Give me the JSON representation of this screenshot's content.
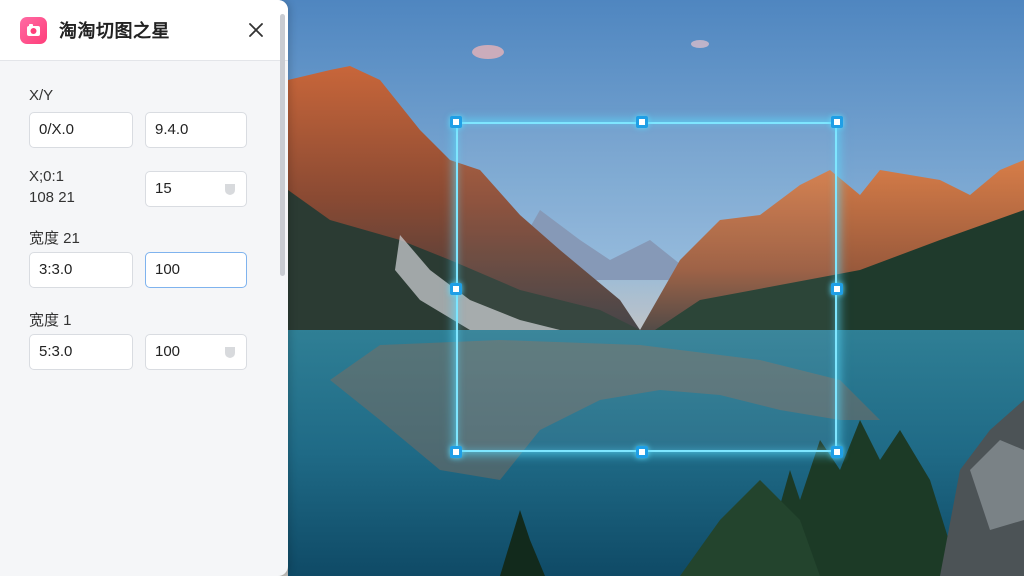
{
  "app": {
    "title": "淘淘切图之星",
    "logo_icon": "app-logo-icon",
    "close_icon": "close-icon"
  },
  "panel": {
    "xy_label": "X/Y",
    "x_value": "0/X.0",
    "y_value": "9.4.0",
    "ratio_label_line1": "X;0:1",
    "ratio_label_line2": "108 21",
    "ratio_value": "15",
    "width_label_a": "宽度 21",
    "width_value_a": "3:3.0",
    "height_value_a": "100",
    "width_label_b": "宽度 1",
    "width_value_b": "5:3.0",
    "height_value_b": "100"
  },
  "colors": {
    "accent": "#1f9fe6",
    "crop_glow": "#7fe6ff",
    "active_border": "#7fb3ee",
    "logo": "#ff3e7a"
  }
}
